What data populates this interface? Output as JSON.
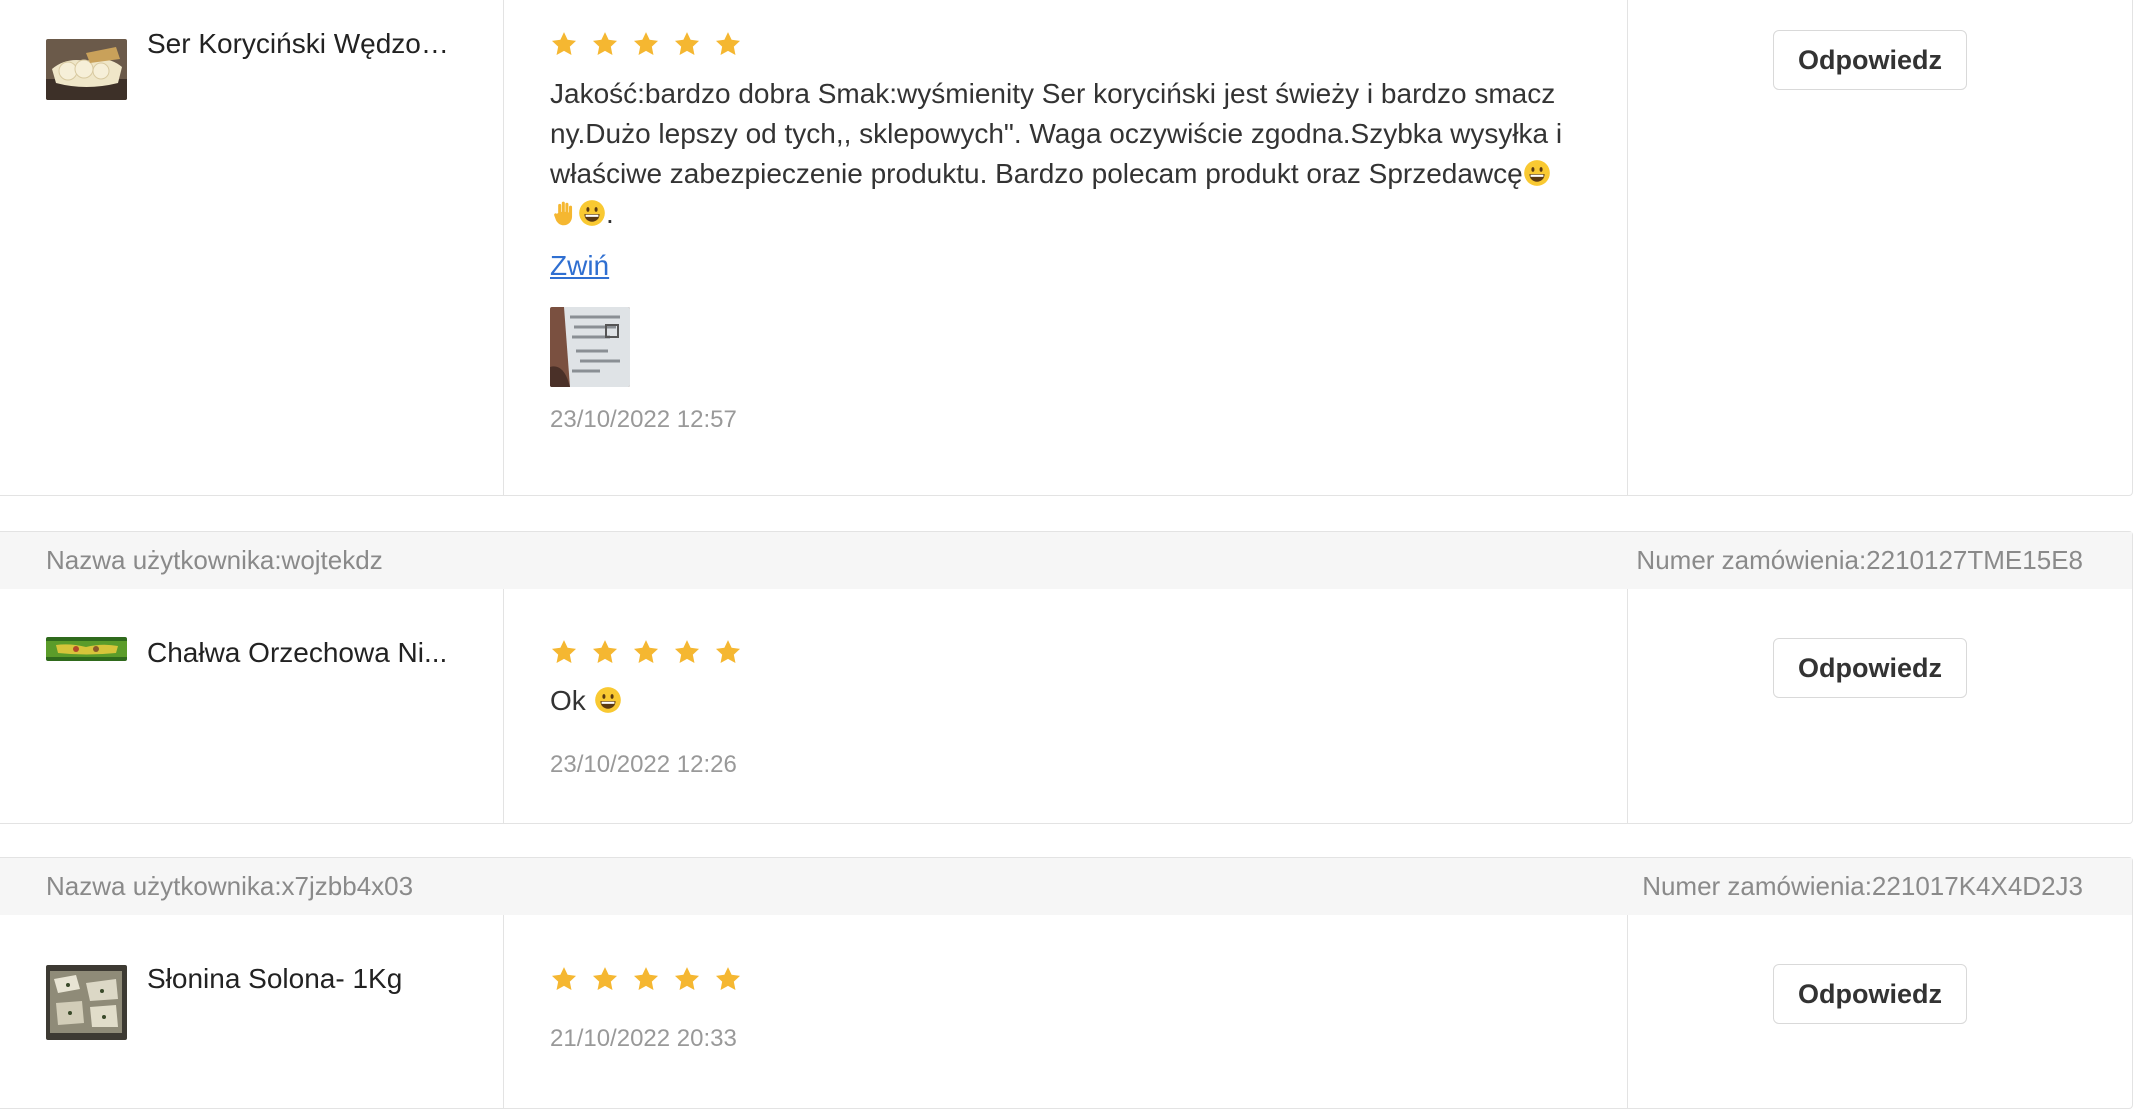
{
  "reviews": [
    {
      "product_name": "Ser Koryciński Wędzon...",
      "rating": 5,
      "text_lines": [
        "Jakość:bardzo dobra Smak:wyśmienity Ser koryciński jest świeży i bardzo smacz",
        "ny.Dużo lepszy od tych,, sklepowych\". Waga oczywiście zgodna.Szybka wysyłka i",
        "właściwe zabezpieczenie produktu. Bardzo polecam produkt oraz Sprzedawcę"
      ],
      "text_tail": ".",
      "emojis": [
        "grinning-face",
        "raised-hand",
        "grinning-face"
      ],
      "collapse_label": "Zwiń",
      "date": "23/10/2022 12:57",
      "reply_label": "Odpowiedz"
    },
    {
      "user_label": "Nazwa użytkownika:wojtekdz",
      "order_label": "Numer zamówienia:2210127TME15E8",
      "product_name": "Chałwa Orzechowa Ni...",
      "rating": 5,
      "text": "Ok",
      "emojis": [
        "beaming-face"
      ],
      "date": "23/10/2022 12:26",
      "reply_label": "Odpowiedz"
    },
    {
      "user_label": "Nazwa użytkownika:x7jzbb4x03",
      "order_label": "Numer zamówienia:221017K4X4D2J3",
      "product_name": "Słonina Solona- 1Kg",
      "rating": 5,
      "date": "21/10/2022 20:33",
      "reply_label": "Odpowiedz"
    }
  ],
  "colors": {
    "star": "#f5b731",
    "link": "#2f6fd1",
    "header_bg": "#f6f6f6",
    "border": "#e3e3e3",
    "muted_text": "#8a8a8a"
  }
}
